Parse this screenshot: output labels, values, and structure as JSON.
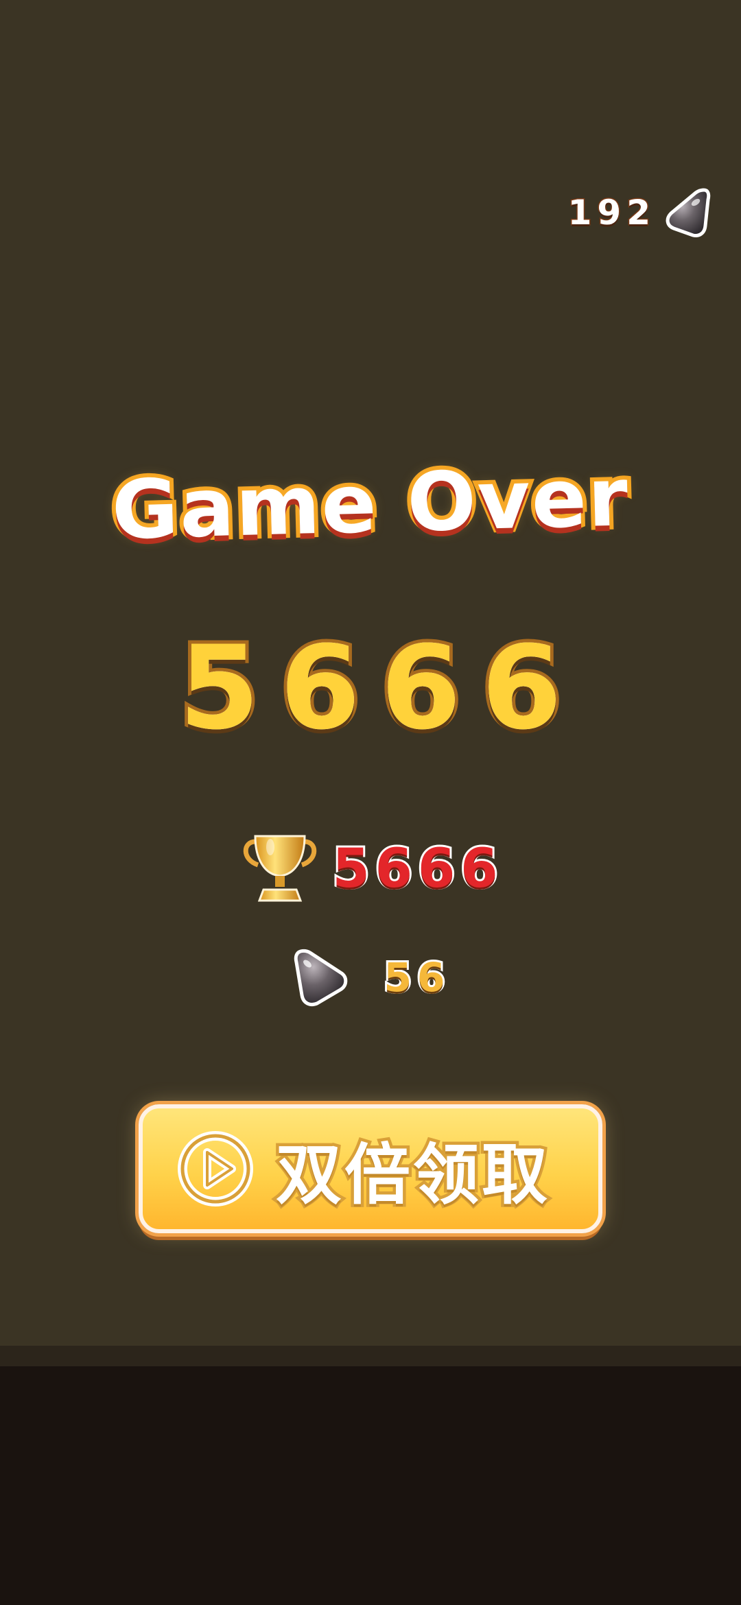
{
  "hud": {
    "gems_total": "192",
    "gem_icon": "gem-icon"
  },
  "result": {
    "title": "Game Over",
    "score": "5666",
    "best_score": "5666",
    "best_icon": "trophy-icon",
    "gems_earned": "56",
    "gems_icon": "gem-icon"
  },
  "actions": {
    "double_label": "双倍领取",
    "double_icon": "play-circle-icon"
  },
  "colors": {
    "background": "#3b3424",
    "floor": "#1a130f",
    "title_outline": "#f4a21f",
    "score_fill": "#ffd23a",
    "best_score": "#e3262a",
    "gems_earned": "#f5b83a",
    "button_fill": "#ffd24a"
  }
}
